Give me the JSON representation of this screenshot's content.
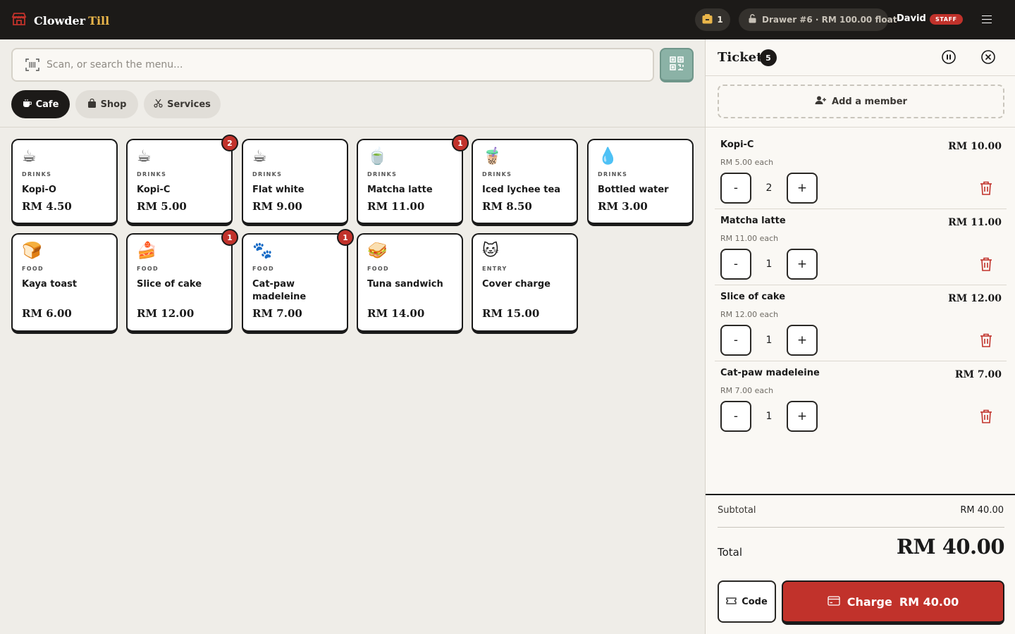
{
  "header": {
    "brand_name": "Clowder",
    "brand_sub": "Till",
    "tray_count": "1",
    "drawer_label": "Drawer #6 · RM 100.00 float",
    "user_name": "David",
    "role_badge": "STAFF"
  },
  "search": {
    "placeholder": "Scan, or search the menu..."
  },
  "tabs": [
    {
      "label": "Cafe",
      "active": true
    },
    {
      "label": "Shop",
      "active": false
    },
    {
      "label": "Services",
      "active": false
    }
  ],
  "products": [
    {
      "emoji": "☕",
      "category": "DRINKS",
      "name": "Kopi-O",
      "price": "RM 4.50",
      "badge": ""
    },
    {
      "emoji": "☕",
      "category": "DRINKS",
      "name": "Kopi-C",
      "price": "RM 5.00",
      "badge": "2"
    },
    {
      "emoji": "☕",
      "category": "DRINKS",
      "name": "Flat white",
      "price": "RM 9.00",
      "badge": ""
    },
    {
      "emoji": "🍵",
      "category": "DRINKS",
      "name": "Matcha latte",
      "price": "RM 11.00",
      "badge": "1"
    },
    {
      "emoji": "🧋",
      "category": "DRINKS",
      "name": "Iced lychee tea",
      "price": "RM 8.50",
      "badge": ""
    },
    {
      "emoji": "💧",
      "category": "DRINKS",
      "name": "Bottled water",
      "price": "RM 3.00",
      "badge": ""
    },
    {
      "emoji": "🍞",
      "category": "FOOD",
      "name": "Kaya toast",
      "price": "RM 6.00",
      "badge": ""
    },
    {
      "emoji": "🍰",
      "category": "FOOD",
      "name": "Slice of cake",
      "price": "RM 12.00",
      "badge": "1"
    },
    {
      "emoji": "🐾",
      "category": "FOOD",
      "name": "Cat-paw madeleine",
      "price": "RM 7.00",
      "badge": "1"
    },
    {
      "emoji": "🥪",
      "category": "FOOD",
      "name": "Tuna sandwich",
      "price": "RM 14.00",
      "badge": ""
    },
    {
      "emoji": "🐱",
      "category": "ENTRY",
      "name": "Cover charge",
      "price": "RM 15.00",
      "badge": ""
    }
  ],
  "ticket": {
    "title": "Ticket",
    "count": "5",
    "add_member_label": "Add a member",
    "items": [
      {
        "name": "Kopi-C",
        "total": "RM 10.00",
        "each": "RM 5.00 each",
        "qty": "2"
      },
      {
        "name": "Matcha latte",
        "total": "RM 11.00",
        "each": "RM 11.00 each",
        "qty": "1"
      },
      {
        "name": "Slice of cake",
        "total": "RM 12.00",
        "each": "RM 12.00 each",
        "qty": "1"
      },
      {
        "name": "Cat-paw madeleine",
        "total": "RM 7.00",
        "each": "RM 7.00 each",
        "qty": "1"
      }
    ],
    "minus_label": "-",
    "plus_label": "+",
    "subtotal_label": "Subtotal",
    "subtotal_value": "RM 40.00",
    "total_label": "Total",
    "total_value": "RM 40.00",
    "code_label": "Code",
    "charge_label": "Charge",
    "charge_amount": "RM 40.00"
  },
  "colors": {
    "accent_red": "#c1322b",
    "brand_gold": "#e9b54a",
    "topbar": "#1c1a18",
    "scan_green": "#8bb2a6"
  }
}
